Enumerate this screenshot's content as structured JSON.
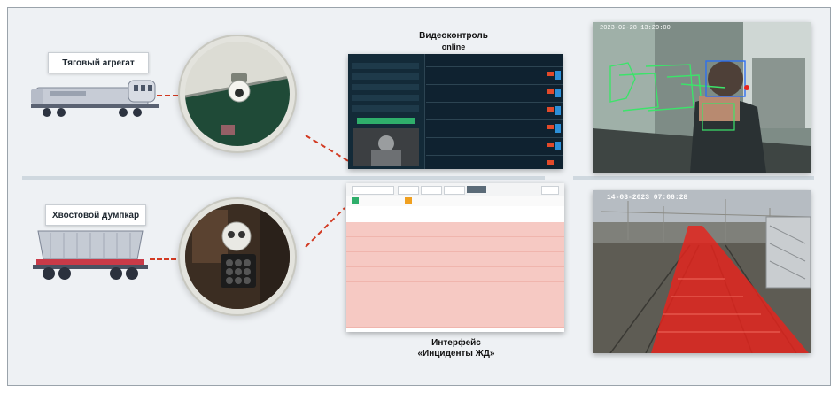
{
  "labels": {
    "traction_unit": "Тяговый агрегат",
    "tail_dumpcar": "Хвостовой думпкар"
  },
  "captions": {
    "video_title": "Видеоконтроль",
    "video_subtitle": "online",
    "interface_title": "Интерфейс",
    "interface_subtitle": "«Инциденты ЖД»"
  },
  "photos": {
    "cab_timestamp": "2023-02-28 13:20:00",
    "track_timestamp": "14-03-2023 07:06:28"
  },
  "colors": {
    "accent_green": "#2fae6b",
    "dashed_line_red": "#d23a22",
    "track_overlay_red": "#e8231c",
    "incident_row_pink": "#f6c9c3",
    "dark_ui": "#0f2230"
  }
}
